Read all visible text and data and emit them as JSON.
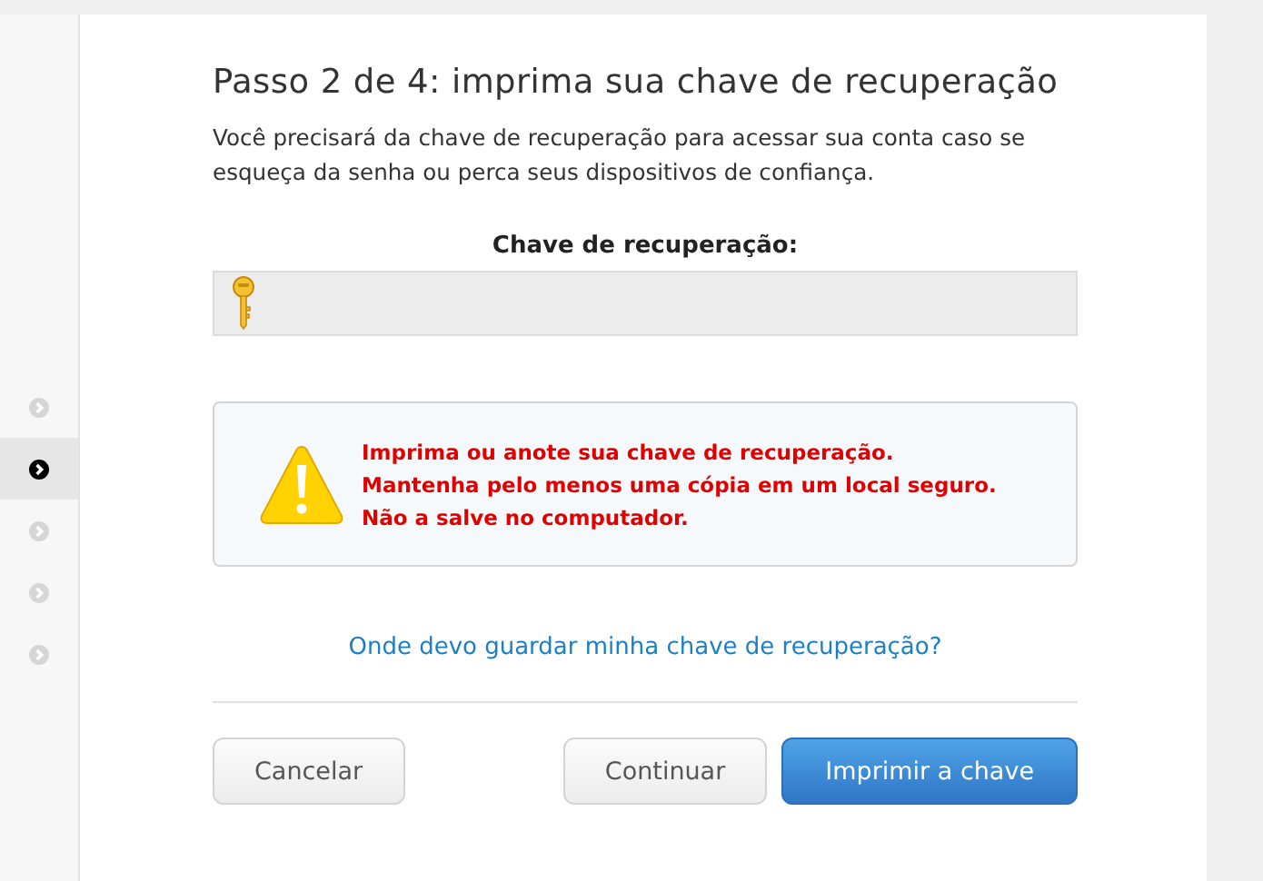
{
  "steps": [
    {
      "selected": false
    },
    {
      "selected": true
    },
    {
      "selected": false
    },
    {
      "selected": false
    },
    {
      "selected": false
    }
  ],
  "title": "Passo 2 de 4: imprima sua chave de recuperação",
  "intro": "Você precisará da chave de recuperação para acessar sua conta caso se esqueça da senha ou perca seus dispositivos de confiança.",
  "key_label": "Chave de recuperação:",
  "warning": [
    "Imprima ou anote sua chave de recuperação.",
    "Mantenha pelo menos uma cópia em um local seguro.",
    "Não a salve no computador."
  ],
  "help_link": "Onde devo guardar minha chave de recuperação?",
  "buttons": [
    {
      "label": "Cancelar",
      "kind": "secondary"
    },
    {
      "label": "Continuar",
      "kind": "secondary"
    },
    {
      "label": "Imprimir a chave",
      "kind": "primary"
    }
  ]
}
